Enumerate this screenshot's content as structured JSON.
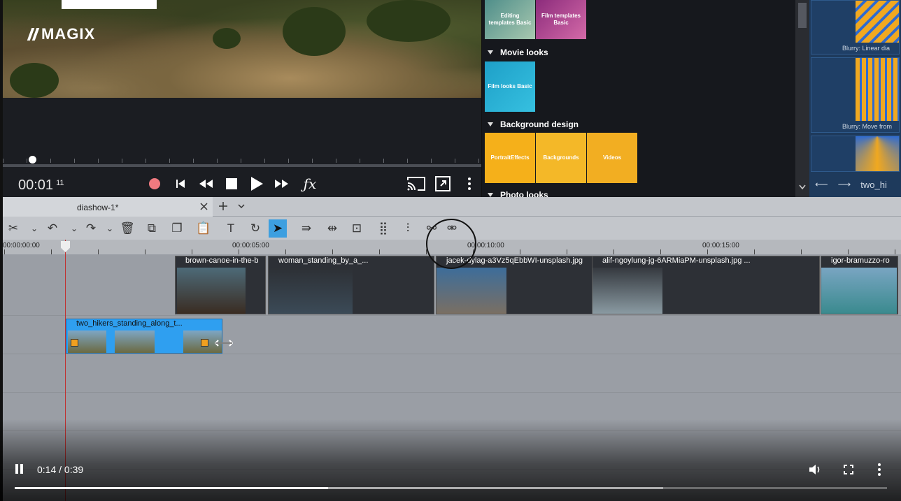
{
  "logo": {
    "text": "MAGIX"
  },
  "preview": {
    "timecode_main": "00:01",
    "timecode_frames": "11"
  },
  "browser": {
    "sections": [
      {
        "label": "Movie looks"
      },
      {
        "label": "Background design"
      },
      {
        "label": "Photo looks"
      }
    ],
    "tiles_top": [
      {
        "label": "Editing templates Basic",
        "color": "#5aa3a0"
      },
      {
        "label": "Film templates Basic",
        "color": "#a43c8c"
      }
    ],
    "movie_looks": [
      {
        "label": "Film looks Basic",
        "color": "#1ea0c8"
      }
    ],
    "background_design": [
      {
        "label": "PortraitEffects",
        "color": "#f5b01a"
      },
      {
        "label": "Backgrounds",
        "color": "#f4b828"
      },
      {
        "label": "Videos",
        "color": "#f2ae22"
      }
    ]
  },
  "transitions": {
    "items": [
      {
        "caption": "Blurry: Linear dia"
      },
      {
        "caption": "Blurry: Move from"
      },
      {
        "caption": ""
      }
    ],
    "nav_label": "two_hi"
  },
  "tabs": {
    "project": "diashow-1*"
  },
  "ruler": {
    "labels": [
      "00:00:00:00",
      "00:00:05:00",
      "00:00:10:00",
      "00:00:15:00"
    ]
  },
  "clips": [
    {
      "title": "brown-canoe-in-the-b",
      "colors": [
        "#4d6a78",
        "#3a2c22"
      ]
    },
    {
      "title": "woman_standing_by_a_...",
      "colors": [
        "#2d3035",
        "#3b4a57"
      ]
    },
    {
      "title": "jacek-dylag-a3Vz5qEbbWI-unsplash.jpg",
      "colors": [
        "#3d6d9a",
        "#7a6f63"
      ]
    },
    {
      "title": "alif-ngoylung-jg-6ARMiaPM-unsplash.jpg ...",
      "colors": [
        "#35393f",
        "#8a9aa2"
      ]
    },
    {
      "title": "igor-bramuzzo-ro",
      "colors": [
        "#79a5c2",
        "#3a8a8e"
      ]
    }
  ],
  "title_clip": {
    "title": "two_hikers_standing_along_t..."
  },
  "player": {
    "time": "0:14 / 0:39",
    "played_fraction": 0.359,
    "buffered_fraction": 0.743
  },
  "icons": {
    "tb": [
      "scissors-icon",
      "chevron-down-icon",
      "undo-icon",
      "chevron-down-icon",
      "redo-icon",
      "chevron-down-icon",
      "delete-icon",
      "cut-icon",
      "copy-icon",
      "paste-icon",
      "text-icon",
      "rotate-icon",
      "pointer-icon",
      "multi-select-icon",
      "split-icon",
      "crop-icon",
      "fit-icon",
      "audio-icon",
      "link-icon",
      "unlink-icon"
    ]
  }
}
